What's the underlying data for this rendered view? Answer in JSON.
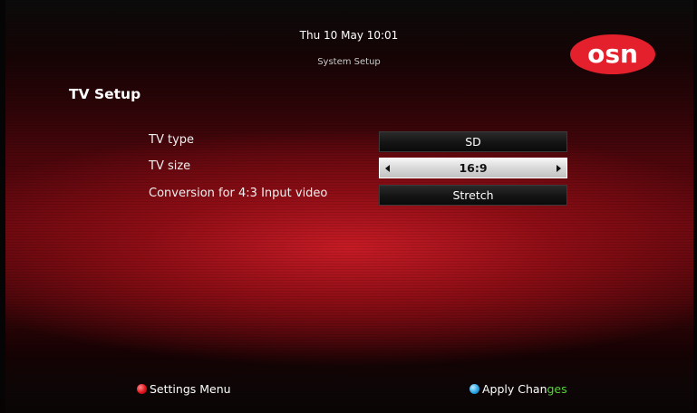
{
  "header": {
    "datetime": "Thu 10 May 10:01",
    "subtitle": "System Setup",
    "logo_text": "osn"
  },
  "page": {
    "title": "TV Setup"
  },
  "settings": [
    {
      "label": "TV type",
      "value": "SD",
      "selected": false
    },
    {
      "label": "TV size",
      "value": "16:9",
      "selected": true
    },
    {
      "label": "Conversion for 4:3 Input video",
      "value": "Stretch",
      "selected": false
    }
  ],
  "footer": {
    "settings_menu": "Settings Menu",
    "apply_changes_prefix": "Apply Chan",
    "apply_changes_accent": "ges"
  },
  "colors": {
    "red_key": "#e0161e",
    "blue_key": "#2aa6e6",
    "logo_red": "#e3202b",
    "accent_green": "#56d23a"
  },
  "icons": {
    "red_button": "red-dot-icon",
    "blue_button": "blue-dot-icon",
    "value_left": "left-arrow-icon",
    "value_right": "right-arrow-icon"
  }
}
